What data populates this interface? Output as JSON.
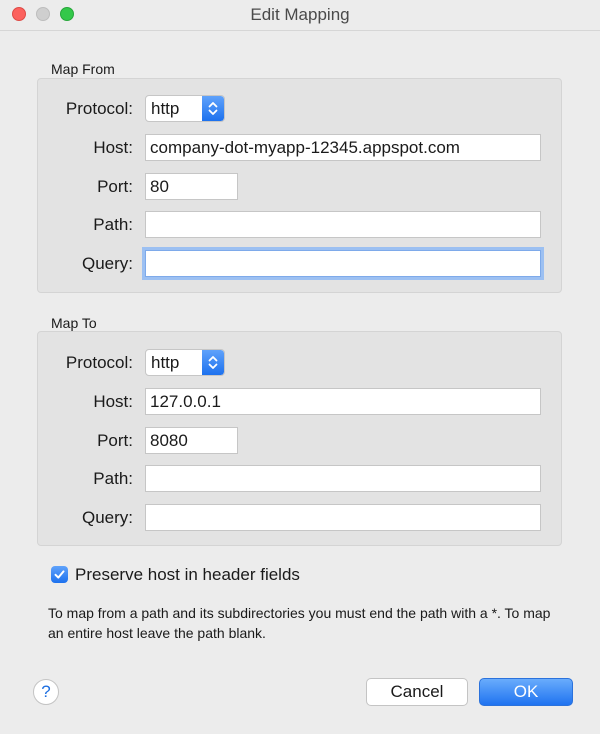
{
  "window": {
    "title": "Edit Mapping"
  },
  "map_from": {
    "section_label": "Map From",
    "protocol_label": "Protocol:",
    "protocol_value": "http",
    "host_label": "Host:",
    "host_value": "company-dot-myapp-12345.appspot.com",
    "port_label": "Port:",
    "port_value": "80",
    "path_label": "Path:",
    "path_value": "",
    "query_label": "Query:",
    "query_value": ""
  },
  "map_to": {
    "section_label": "Map To",
    "protocol_label": "Protocol:",
    "protocol_value": "http",
    "host_label": "Host:",
    "host_value": "127.0.0.1",
    "port_label": "Port:",
    "port_value": "8080",
    "path_label": "Path:",
    "path_value": "",
    "query_label": "Query:",
    "query_value": ""
  },
  "options": {
    "preserve_host_label": "Preserve host in header fields",
    "preserve_host_checked": true
  },
  "help_text": "To map from a path and its subdirectories you must end the path with a *. To map an entire host leave the path blank.",
  "buttons": {
    "help_label": "?",
    "cancel_label": "Cancel",
    "ok_label": "OK"
  },
  "colors": {
    "accent": "#1f73f0",
    "close": "#fc615d",
    "minimize_inactive": "#cfcfcf",
    "maximize": "#34c84a",
    "focus_ring": "#9cc0f2"
  },
  "icons": {
    "protocol_select": "chevron-updown-icon",
    "checkbox": "checkmark-icon"
  }
}
